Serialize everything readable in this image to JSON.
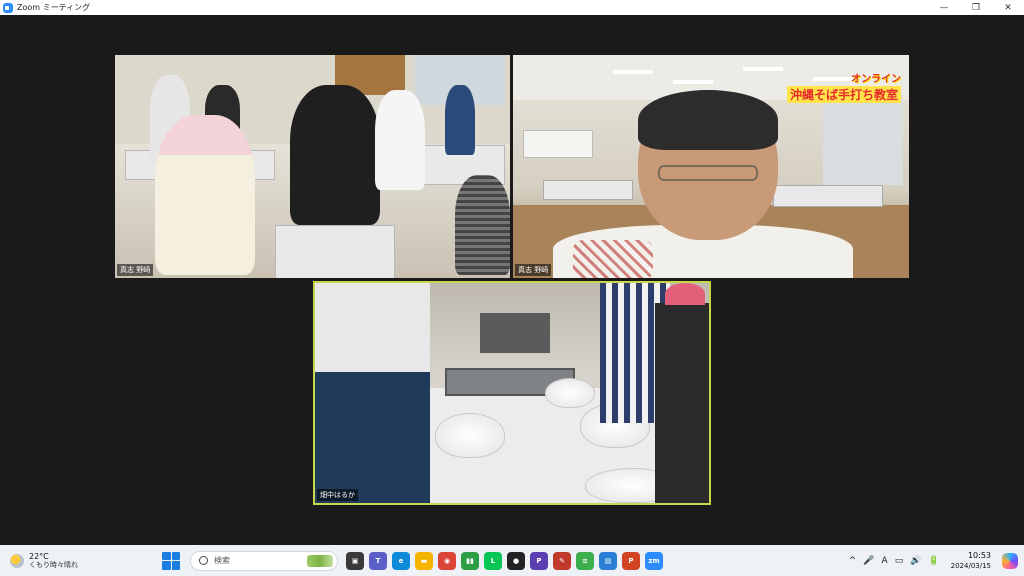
{
  "window": {
    "title": "Zoom ミーティング",
    "minimize": "—",
    "restore": "❐",
    "close": "✕"
  },
  "participants": [
    {
      "name": "真志 野崎"
    },
    {
      "name": "真志 野崎",
      "overlay_line1": "オンライン",
      "overlay_line2": "沖縄そば手打ち教室"
    },
    {
      "name": "畑中はるか"
    }
  ],
  "taskbar": {
    "weather_temp": "22°C",
    "weather_condition": "くもり時々晴れ",
    "search_placeholder": "検索",
    "time": "10:53",
    "date": "2024/03/15",
    "ime": "A",
    "apps": [
      {
        "name": "task-view",
        "label": "▣",
        "color": "#3a3a3a"
      },
      {
        "name": "teams",
        "label": "T",
        "color": "#5b5fc7"
      },
      {
        "name": "edge",
        "label": "e",
        "color": "#0f8ad8"
      },
      {
        "name": "file-explorer",
        "label": "▬",
        "color": "#f4b400"
      },
      {
        "name": "chrome",
        "label": "◉",
        "color": "#db4437"
      },
      {
        "name": "app-green",
        "label": "▮▮",
        "color": "#2e9e44"
      },
      {
        "name": "line",
        "label": "L",
        "color": "#06c755"
      },
      {
        "name": "app-dark",
        "label": "●",
        "color": "#222222"
      },
      {
        "name": "app-purple",
        "label": "P",
        "color": "#5b3fb0"
      },
      {
        "name": "paint",
        "label": "✎",
        "color": "#c0392b"
      },
      {
        "name": "app-stack",
        "label": "≡",
        "color": "#3cae4e"
      },
      {
        "name": "notepad",
        "label": "▤",
        "color": "#2a7fd4"
      },
      {
        "name": "powerpoint",
        "label": "P",
        "color": "#d04423"
      },
      {
        "name": "zoom",
        "label": "zm",
        "color": "#2d8cff"
      }
    ],
    "tray": [
      "^",
      "🎤",
      "A",
      "▭",
      "🔊",
      "🔋"
    ]
  }
}
